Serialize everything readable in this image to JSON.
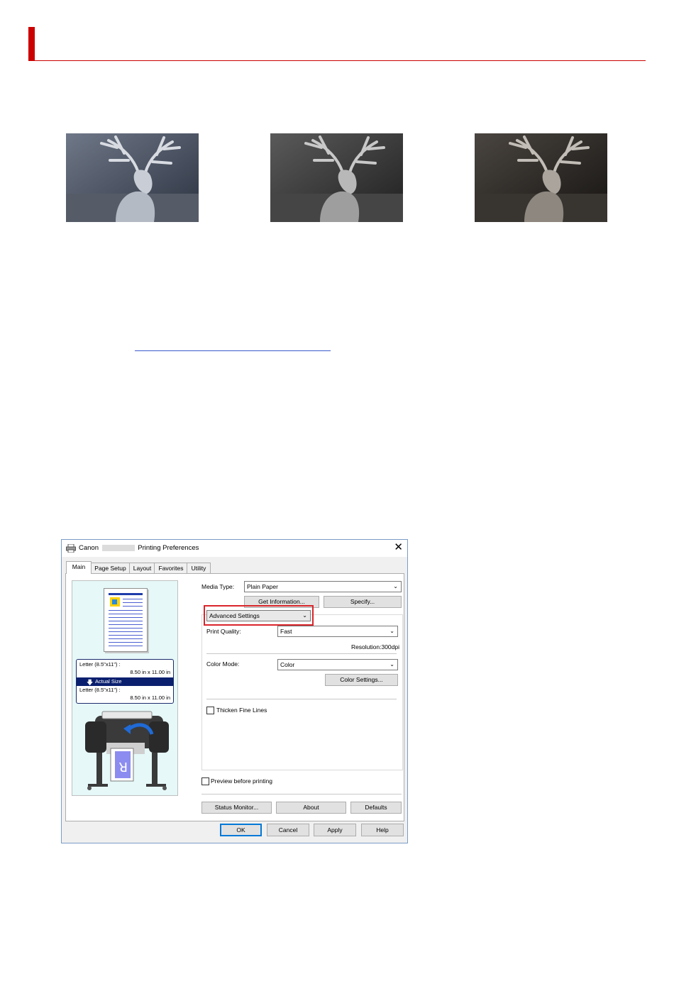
{
  "dialog": {
    "title_brand": "Canon",
    "title_suffix": "Printing Preferences",
    "close_glyph": "✕",
    "tabs": [
      {
        "label": "Main",
        "active": true
      },
      {
        "label": "Page Setup"
      },
      {
        "label": "Layout"
      },
      {
        "label": "Favorites"
      },
      {
        "label": "Utility"
      }
    ],
    "preview": {
      "input_size_label": "Letter (8.5\"x11\") :",
      "input_size_value": "8.50 in x 11.00 in",
      "scaling_label": "Actual Size",
      "output_size_label": "Letter (8.5\"x11\") :",
      "output_size_value": "8.50 in x 11.00 in",
      "printer_sheet_glyph": "R"
    },
    "media_type_label": "Media Type:",
    "media_type_value": "Plain Paper",
    "get_information_button": "Get Information...",
    "specify_button": "Specify...",
    "settings_mode_value": "Advanced Settings",
    "print_quality_label": "Print Quality:",
    "print_quality_value": "Fast",
    "resolution_text": "Resolution:300dpi",
    "color_mode_label": "Color Mode:",
    "color_mode_value": "Color",
    "color_settings_button": "Color Settings...",
    "thicken_fine_lines_label": "Thicken Fine Lines",
    "preview_before_printing_label": "Preview before printing",
    "status_monitor_button": "Status Monitor...",
    "about_button": "About",
    "defaults_button": "Defaults",
    "ok_button": "OK",
    "cancel_button": "Cancel",
    "apply_button": "Apply",
    "help_button": "Help",
    "chevron_glyph": "⌄",
    "arrow_glyph": "🡇",
    "colors": {
      "highlight": "#d9252b",
      "selected_bar": "#0a1f6e",
      "preview_bg": "#e6f8f8"
    }
  },
  "header": {
    "accent_color": "#cc0000"
  }
}
